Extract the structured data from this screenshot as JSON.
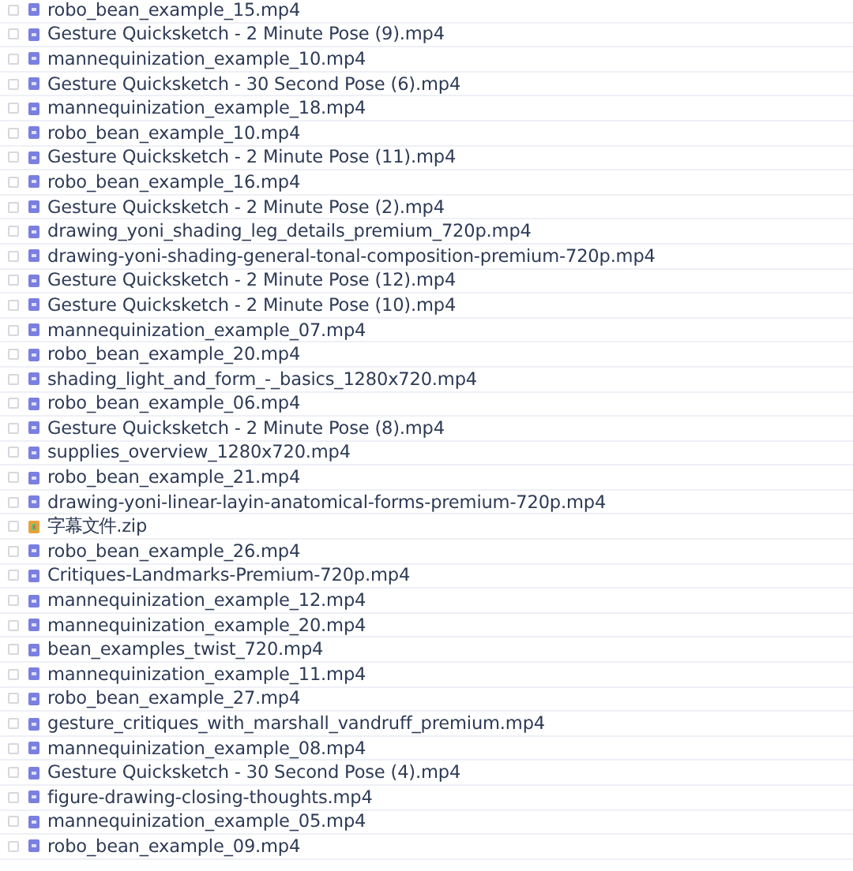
{
  "files": [
    {
      "name": "robo_bean_example_15.mp4",
      "kind": "video",
      "checked": false
    },
    {
      "name": "Gesture Quicksketch - 2 Minute Pose (9).mp4",
      "kind": "video",
      "checked": false
    },
    {
      "name": "mannequinization_example_10.mp4",
      "kind": "video",
      "checked": false
    },
    {
      "name": "Gesture Quicksketch - 30 Second Pose (6).mp4",
      "kind": "video",
      "checked": false
    },
    {
      "name": "mannequinization_example_18.mp4",
      "kind": "video",
      "checked": false
    },
    {
      "name": "robo_bean_example_10.mp4",
      "kind": "video",
      "checked": false
    },
    {
      "name": "Gesture Quicksketch - 2 Minute Pose (11).mp4",
      "kind": "video",
      "checked": false
    },
    {
      "name": "robo_bean_example_16.mp4",
      "kind": "video",
      "checked": false
    },
    {
      "name": "Gesture Quicksketch - 2 Minute Pose (2).mp4",
      "kind": "video",
      "checked": false
    },
    {
      "name": "drawing_yoni_shading_leg_details_premium_720p.mp4",
      "kind": "video",
      "checked": false
    },
    {
      "name": "drawing-yoni-shading-general-tonal-composition-premium-720p.mp4",
      "kind": "video",
      "checked": false
    },
    {
      "name": "Gesture Quicksketch - 2 Minute Pose (12).mp4",
      "kind": "video",
      "checked": false
    },
    {
      "name": "Gesture Quicksketch - 2 Minute Pose (10).mp4",
      "kind": "video",
      "checked": false
    },
    {
      "name": "mannequinization_example_07.mp4",
      "kind": "video",
      "checked": false
    },
    {
      "name": "robo_bean_example_20.mp4",
      "kind": "video",
      "checked": false
    },
    {
      "name": "shading_light_and_form_-_basics_1280x720.mp4",
      "kind": "video",
      "checked": false
    },
    {
      "name": "robo_bean_example_06.mp4",
      "kind": "video",
      "checked": false
    },
    {
      "name": "Gesture Quicksketch - 2 Minute Pose (8).mp4",
      "kind": "video",
      "checked": false
    },
    {
      "name": "supplies_overview_1280x720.mp4",
      "kind": "video",
      "checked": false
    },
    {
      "name": "robo_bean_example_21.mp4",
      "kind": "video",
      "checked": false
    },
    {
      "name": "drawing-yoni-linear-layin-anatomical-forms-premium-720p.mp4",
      "kind": "video",
      "checked": false
    },
    {
      "name": "字幕文件.zip",
      "kind": "archive",
      "checked": false
    },
    {
      "name": "robo_bean_example_26.mp4",
      "kind": "video",
      "checked": false
    },
    {
      "name": "Critiques-Landmarks-Premium-720p.mp4",
      "kind": "video",
      "checked": false
    },
    {
      "name": "mannequinization_example_12.mp4",
      "kind": "video",
      "checked": false
    },
    {
      "name": "mannequinization_example_20.mp4",
      "kind": "video",
      "checked": false
    },
    {
      "name": "bean_examples_twist_720.mp4",
      "kind": "video",
      "checked": false
    },
    {
      "name": "mannequinization_example_11.mp4",
      "kind": "video",
      "checked": false
    },
    {
      "name": "robo_bean_example_27.mp4",
      "kind": "video",
      "checked": false
    },
    {
      "name": "gesture_critiques_with_marshall_vandruff_premium.mp4",
      "kind": "video",
      "checked": false
    },
    {
      "name": "mannequinization_example_08.mp4",
      "kind": "video",
      "checked": false
    },
    {
      "name": "Gesture Quicksketch - 30 Second Pose (4).mp4",
      "kind": "video",
      "checked": false
    },
    {
      "name": "figure-drawing-closing-thoughts.mp4",
      "kind": "video",
      "checked": false
    },
    {
      "name": "mannequinization_example_05.mp4",
      "kind": "video",
      "checked": false
    },
    {
      "name": "robo_bean_example_09.mp4",
      "kind": "video",
      "checked": false
    }
  ]
}
